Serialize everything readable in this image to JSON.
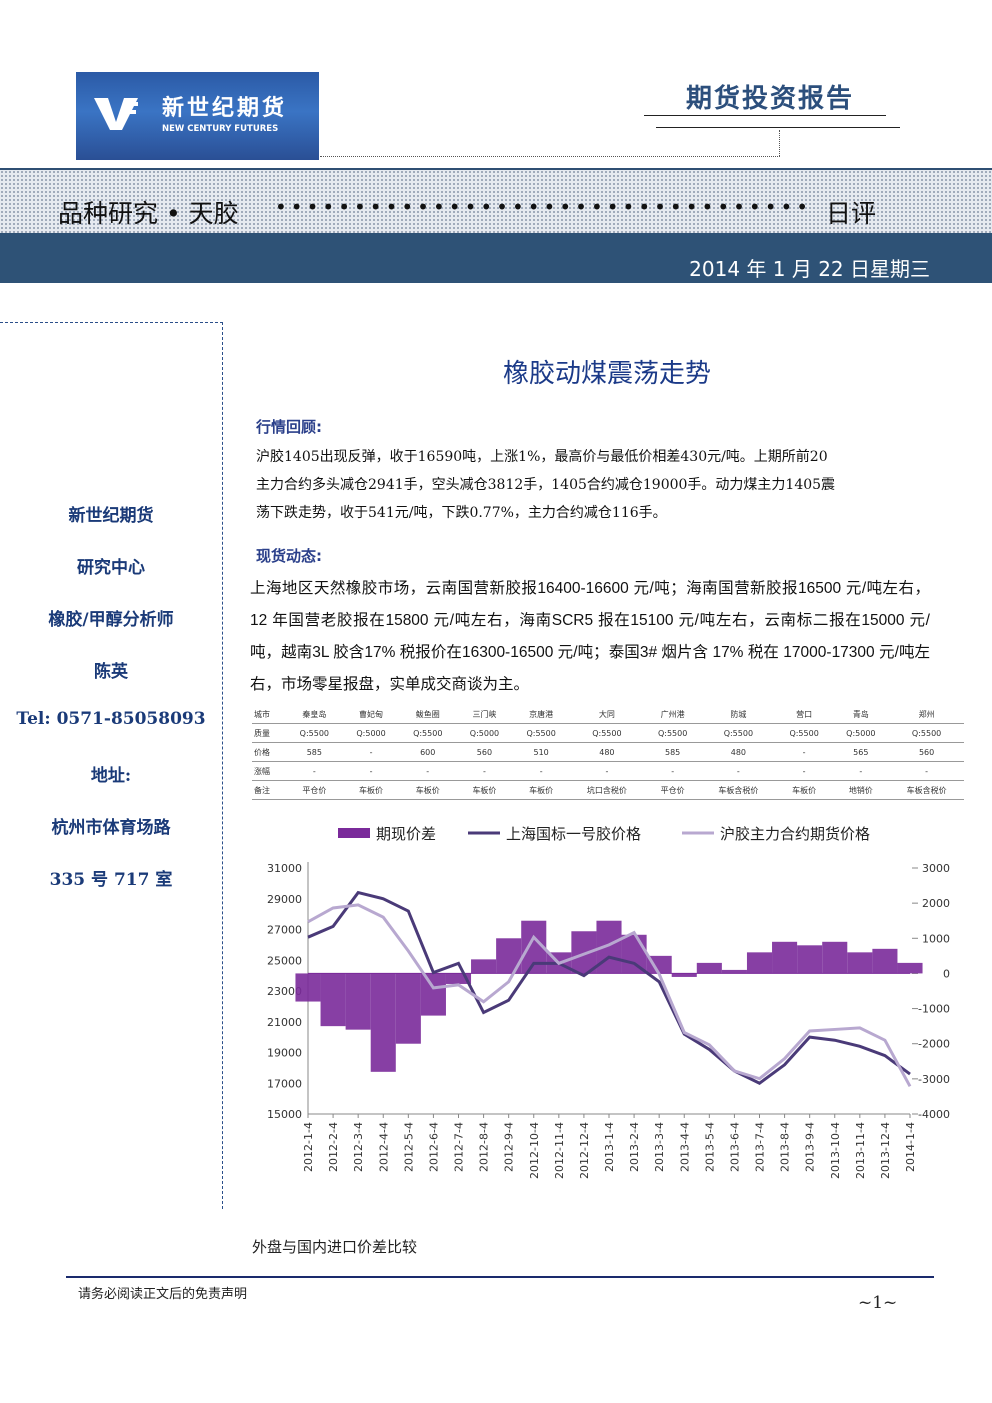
{
  "header": {
    "logo_cn": "新世纪期货",
    "logo_en": "NEW CENTURY FUTURES",
    "report_type": "期货投资报告"
  },
  "band": {
    "title": "品种研究 • 天胶",
    "dots": "••••••••••••••••••••••••••••••••••",
    "suffix": "日评",
    "date": "2014 年 1 月 22 日星期三"
  },
  "sidebar": {
    "company": "新世纪期货",
    "dept": "研究中心",
    "role": "橡胶/甲醇分析师",
    "name": "陈英",
    "tel": "Tel: 0571-85058093",
    "addr_label": "地址:",
    "addr_line1": "杭州市体育场路",
    "addr_line2": "335 号 717 室"
  },
  "main": {
    "title": "橡胶动煤震荡走势",
    "review_head": "行情回顾:",
    "review_lines": [
      "沪胶1405出现反弹，收于16590吨，上涨1%，最高价与最低价相差430元/吨。上期所前20",
      "主力合约多头减仓2941手，空头减仓3812手，1405合约减仓19000手。动力煤主力1405震",
      "荡下跌走势，收于541元/吨，下跌0.77%，主力合约减仓116手。"
    ],
    "spot_head": "现货动态:",
    "spot_text": "上海地区天然橡胶市场，云南国营新胶报16400-16600 元/吨；海南国营新胶报16500 元/吨左右，12 年国营老胶报在15800 元/吨左右，海南SCR5 报在15100 元/吨左右，云南标二报在15000 元/吨，越南3L 胶含17% 税报价在16300-16500 元/吨；泰国3# 烟片含 17% 税在 17000-17300  元/吨左右，市场零星报盘，实单成交商谈为主。",
    "caption": "外盘与国内进口价差比较"
  },
  "spot_table": {
    "rows": [
      [
        "城市",
        "秦皇岛",
        "曹妃甸",
        "鲅鱼圈",
        "三门峡",
        "京唐港",
        "大同",
        "广州港",
        "防城",
        "营口",
        "青岛",
        "郑州"
      ],
      [
        "质量",
        "Q:5500",
        "Q:5000",
        "Q:5500",
        "Q:5000",
        "Q:5500",
        "Q:5500",
        "Q:5500",
        "Q:5500",
        "Q:5500",
        "Q:5000",
        "Q:5500"
      ],
      [
        "价格",
        "585",
        "-",
        "600",
        "560",
        "510",
        "480",
        "585",
        "480",
        "-",
        "565",
        "560"
      ],
      [
        "涨幅",
        "-",
        "-",
        "-",
        "-",
        "-",
        "-",
        "-",
        "-",
        "-",
        "-",
        "-"
      ],
      [
        "备注",
        "平仓价",
        "车板价",
        "车板价",
        "车板价",
        "车板价",
        "坑口含税价",
        "平仓价",
        "车板含税价",
        "车板价",
        "地销价",
        "车板含税价"
      ]
    ]
  },
  "chart_data": {
    "type": "line",
    "legend": [
      "期现价差",
      "上海国标一号胶价格",
      "沪胶主力合约期货价格"
    ],
    "x": [
      "2012-1-4",
      "2012-2-4",
      "2012-3-4",
      "2012-4-4",
      "2012-5-4",
      "2012-6-4",
      "2012-7-4",
      "2012-8-4",
      "2012-9-4",
      "2012-10-4",
      "2012-11-4",
      "2012-12-4",
      "2013-1-4",
      "2013-2-4",
      "2013-3-4",
      "2013-4-4",
      "2013-5-4",
      "2013-6-4",
      "2013-7-4",
      "2013-8-4",
      "2013-9-4",
      "2013-10-4",
      "2013-11-4",
      "2013-12-4",
      "2014-1-4"
    ],
    "series": [
      {
        "name": "上海国标一号胶价格",
        "axis": "left",
        "color": "#4a3a78",
        "values": [
          26500,
          27200,
          29400,
          29000,
          28200,
          24200,
          24800,
          21600,
          22400,
          24800,
          24800,
          24000,
          25200,
          24800,
          23600,
          20200,
          19200,
          17800,
          17000,
          18200,
          20000,
          19800,
          19400,
          18800,
          17600
        ]
      },
      {
        "name": "沪胶主力合约期货价格",
        "axis": "left",
        "color": "#b8a8d0",
        "values": [
          27500,
          28400,
          28600,
          27800,
          25600,
          23200,
          23400,
          22300,
          23600,
          26500,
          24800,
          25400,
          26000,
          26800,
          24100,
          20300,
          19500,
          17800,
          17300,
          18600,
          20400,
          20500,
          20600,
          19800,
          16800
        ]
      },
      {
        "name": "期现价差",
        "axis": "right",
        "type": "area",
        "color": "#7a2a9a",
        "values": [
          -800,
          -1500,
          -1600,
          -2800,
          -2000,
          -1200,
          -300,
          400,
          1000,
          1500,
          600,
          1200,
          1500,
          1100,
          500,
          -100,
          300,
          100,
          600,
          900,
          800,
          900,
          600,
          700,
          300
        ]
      }
    ],
    "y_left": [
      15000,
      17000,
      19000,
      21000,
      23000,
      25000,
      27000,
      29000,
      31000
    ],
    "y_right": [
      -4000,
      -3000,
      -2000,
      -1000,
      0,
      1000,
      2000,
      3000
    ]
  },
  "footer": {
    "disclaimer": "请务必阅读正文后的免责声明",
    "page": "~1~"
  }
}
